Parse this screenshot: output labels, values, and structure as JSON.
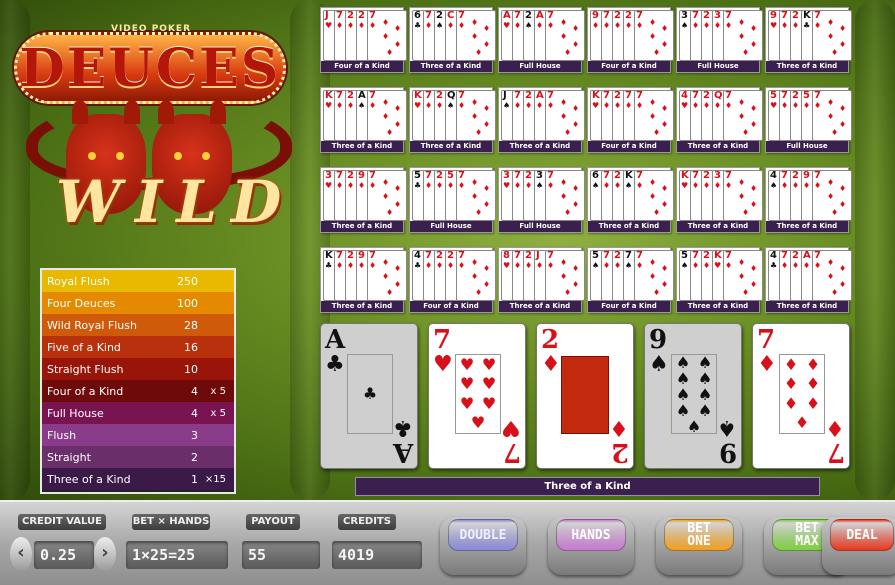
{
  "logo": {
    "subtitle": "VIDEO POKER",
    "title": "DEUCES",
    "wild": "WILD"
  },
  "paytable": [
    {
      "name": "Royal Flush",
      "pay": "250",
      "mult": "",
      "color": "#e9b800"
    },
    {
      "name": "Four Deuces",
      "pay": "100",
      "mult": "",
      "color": "#e58a00"
    },
    {
      "name": "Wild Royal Flush",
      "pay": "28",
      "mult": "",
      "color": "#cf5a0a"
    },
    {
      "name": "Five of a Kind",
      "pay": "16",
      "mult": "",
      "color": "#b8300c"
    },
    {
      "name": "Straight Flush",
      "pay": "10",
      "mult": "",
      "color": "#991409"
    },
    {
      "name": "Four of a Kind",
      "pay": "4",
      "mult": "x 5",
      "color": "#6e0a0a"
    },
    {
      "name": "Full House",
      "pay": "4",
      "mult": "x 5",
      "color": "#7a1450"
    },
    {
      "name": "Flush",
      "pay": "3",
      "mult": "",
      "color": "#8a3c8a"
    },
    {
      "name": "Straight",
      "pay": "2",
      "mult": "",
      "color": "#6a2e6a"
    },
    {
      "name": "Three of a Kind",
      "pay": "1",
      "mult": "×15",
      "color": "#3b1a4a"
    }
  ],
  "mini_hands": [
    {
      "cards": [
        [
          "J",
          "♥"
        ],
        [
          "7",
          "♦"
        ],
        [
          "2",
          "♦"
        ],
        [
          "2",
          "♦"
        ],
        [
          "7",
          "♦"
        ]
      ],
      "label": "Four of a Kind"
    },
    {
      "cards": [
        [
          "6",
          "♣"
        ],
        [
          "7",
          "♦"
        ],
        [
          "2",
          "♠"
        ],
        [
          "C",
          "♦"
        ],
        [
          "7",
          "♦"
        ]
      ],
      "label": "Three of a Kind"
    },
    {
      "cards": [
        [
          "A",
          "♥"
        ],
        [
          "7",
          "♦"
        ],
        [
          "2",
          "♠"
        ],
        [
          "A",
          "♦"
        ],
        [
          "7",
          "♦"
        ]
      ],
      "label": "Full House"
    },
    {
      "cards": [
        [
          "9",
          "♦"
        ],
        [
          "7",
          "♦"
        ],
        [
          "2",
          "♦"
        ],
        [
          "2",
          "♦"
        ],
        [
          "7",
          "♦"
        ]
      ],
      "label": "Four of a Kind"
    },
    {
      "cards": [
        [
          "3",
          "♠"
        ],
        [
          "7",
          "♦"
        ],
        [
          "2",
          "♦"
        ],
        [
          "3",
          "♦"
        ],
        [
          "7",
          "♦"
        ]
      ],
      "label": "Full House"
    },
    {
      "cards": [
        [
          "9",
          "♥"
        ],
        [
          "7",
          "♦"
        ],
        [
          "2",
          "♦"
        ],
        [
          "K",
          "♣"
        ],
        [
          "7",
          "♦"
        ]
      ],
      "label": "Three of a Kind"
    },
    {
      "cards": [
        [
          "K",
          "♥"
        ],
        [
          "7",
          "♦"
        ],
        [
          "2",
          "♦"
        ],
        [
          "A",
          "♠"
        ],
        [
          "7",
          "♦"
        ]
      ],
      "label": "Three of a Kind"
    },
    {
      "cards": [
        [
          "K",
          "♥"
        ],
        [
          "7",
          "♦"
        ],
        [
          "2",
          "♦"
        ],
        [
          "Q",
          "♠"
        ],
        [
          "7",
          "♦"
        ]
      ],
      "label": "Three of a Kind"
    },
    {
      "cards": [
        [
          "J",
          "♠"
        ],
        [
          "7",
          "♦"
        ],
        [
          "2",
          "♦"
        ],
        [
          "A",
          "♦"
        ],
        [
          "7",
          "♦"
        ]
      ],
      "label": "Three of a Kind"
    },
    {
      "cards": [
        [
          "K",
          "♥"
        ],
        [
          "7",
          "♦"
        ],
        [
          "2",
          "♦"
        ],
        [
          "7",
          "♦"
        ],
        [
          "7",
          "♦"
        ]
      ],
      "label": "Four of a Kind"
    },
    {
      "cards": [
        [
          "4",
          "♥"
        ],
        [
          "7",
          "♦"
        ],
        [
          "2",
          "♦"
        ],
        [
          "Q",
          "♦"
        ],
        [
          "7",
          "♦"
        ]
      ],
      "label": "Three of a Kind"
    },
    {
      "cards": [
        [
          "5",
          "♥"
        ],
        [
          "7",
          "♦"
        ],
        [
          "2",
          "♦"
        ],
        [
          "5",
          "♦"
        ],
        [
          "7",
          "♦"
        ]
      ],
      "label": "Full House"
    },
    {
      "cards": [
        [
          "3",
          "♥"
        ],
        [
          "7",
          "♦"
        ],
        [
          "2",
          "♦"
        ],
        [
          "9",
          "♦"
        ],
        [
          "7",
          "♦"
        ]
      ],
      "label": "Three of a Kind"
    },
    {
      "cards": [
        [
          "5",
          "♣"
        ],
        [
          "7",
          "♦"
        ],
        [
          "2",
          "♦"
        ],
        [
          "5",
          "♦"
        ],
        [
          "7",
          "♦"
        ]
      ],
      "label": "Full House"
    },
    {
      "cards": [
        [
          "3",
          "♥"
        ],
        [
          "7",
          "♦"
        ],
        [
          "2",
          "♦"
        ],
        [
          "3",
          "♠"
        ],
        [
          "7",
          "♦"
        ]
      ],
      "label": "Full House"
    },
    {
      "cards": [
        [
          "6",
          "♠"
        ],
        [
          "7",
          "♦"
        ],
        [
          "2",
          "♦"
        ],
        [
          "K",
          "♠"
        ],
        [
          "7",
          "♦"
        ]
      ],
      "label": "Three of a Kind"
    },
    {
      "cards": [
        [
          "K",
          "♥"
        ],
        [
          "7",
          "♦"
        ],
        [
          "2",
          "♦"
        ],
        [
          "3",
          "♦"
        ],
        [
          "7",
          "♦"
        ]
      ],
      "label": "Three of a Kind"
    },
    {
      "cards": [
        [
          "4",
          "♠"
        ],
        [
          "7",
          "♦"
        ],
        [
          "2",
          "♦"
        ],
        [
          "9",
          "♦"
        ],
        [
          "7",
          "♦"
        ]
      ],
      "label": "Three of a Kind"
    },
    {
      "cards": [
        [
          "K",
          "♣"
        ],
        [
          "7",
          "♦"
        ],
        [
          "2",
          "♦"
        ],
        [
          "9",
          "♦"
        ],
        [
          "7",
          "♦"
        ]
      ],
      "label": "Three of a Kind"
    },
    {
      "cards": [
        [
          "4",
          "♣"
        ],
        [
          "7",
          "♦"
        ],
        [
          "2",
          "♦"
        ],
        [
          "2",
          "♦"
        ],
        [
          "7",
          "♦"
        ]
      ],
      "label": "Four of a Kind"
    },
    {
      "cards": [
        [
          "8",
          "♥"
        ],
        [
          "7",
          "♦"
        ],
        [
          "2",
          "♦"
        ],
        [
          "J",
          "♦"
        ],
        [
          "7",
          "♦"
        ]
      ],
      "label": "Three of a Kind"
    },
    {
      "cards": [
        [
          "5",
          "♠"
        ],
        [
          "7",
          "♦"
        ],
        [
          "2",
          "♦"
        ],
        [
          "7",
          "♠"
        ],
        [
          "7",
          "♦"
        ]
      ],
      "label": "Four of a Kind"
    },
    {
      "cards": [
        [
          "5",
          "♠"
        ],
        [
          "7",
          "♦"
        ],
        [
          "2",
          "♦"
        ],
        [
          "K",
          "♥"
        ],
        [
          "7",
          "♦"
        ]
      ],
      "label": "Three of a Kind"
    },
    {
      "cards": [
        [
          "4",
          "♣"
        ],
        [
          "7",
          "♦"
        ],
        [
          "2",
          "♦"
        ],
        [
          "A",
          "♦"
        ],
        [
          "7",
          "♦"
        ]
      ],
      "label": "Three of a Kind"
    }
  ],
  "main_hand": [
    {
      "rank": "A",
      "suit": "♣",
      "color": "blk",
      "held": true,
      "pips": 1
    },
    {
      "rank": "7",
      "suit": "♥",
      "color": "red",
      "held": false,
      "pips": 7
    },
    {
      "rank": "2",
      "suit": "♦",
      "color": "red",
      "held": false,
      "pips": 0
    },
    {
      "rank": "9",
      "suit": "♠",
      "color": "blk",
      "held": true,
      "pips": 9
    },
    {
      "rank": "7",
      "suit": "♦",
      "color": "red",
      "held": false,
      "pips": 7
    }
  ],
  "result": "Three of a Kind",
  "controls": {
    "credit_value_label": "CREDIT VALUE",
    "credit_value": "0.25",
    "bet_hands_label": "BET × HANDS",
    "bet_hands": "1×25=25",
    "payout_label": "PAYOUT",
    "payout": "55",
    "credits_label": "CREDITS",
    "credits": "4019",
    "arrow_left": "‹",
    "arrow_right": "›"
  },
  "buttons": [
    {
      "id": "double",
      "label": "DOUBLE",
      "color": "#8a8ad8",
      "text": "#eef"
    },
    {
      "id": "hands",
      "label": "HANDS",
      "color": "#c67ad0",
      "text": "#fff"
    },
    {
      "id": "bet-one",
      "label": "BET\nONE",
      "color": "#f0a020",
      "text": "#fff"
    },
    {
      "id": "bet-max",
      "label": "BET\nMAX",
      "color": "#7ed040",
      "text": "#fff"
    },
    {
      "id": "deal",
      "label": "DEAL",
      "color": "#e83a20",
      "text": "#fff"
    }
  ]
}
